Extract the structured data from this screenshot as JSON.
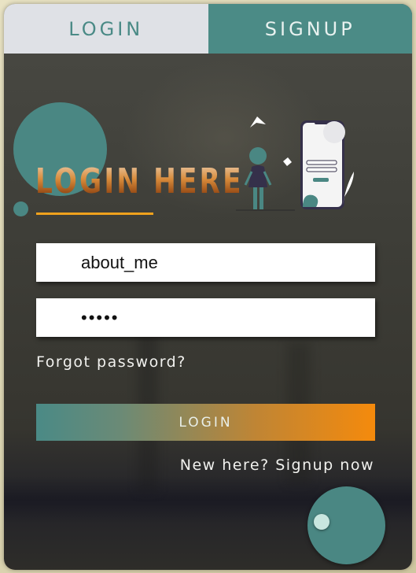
{
  "tabs": {
    "login_label": "LOGIN",
    "signup_label": "SIGNUP"
  },
  "headline": "LOGIN HERE",
  "form": {
    "username_value": "about_me",
    "password_value": "•••••",
    "forgot_label": "Forgot password?",
    "login_button_label": "LOGIN",
    "signup_prompt": "New here? Signup now"
  },
  "colors": {
    "accent_teal": "#4a8783",
    "accent_orange": "#f58a0c",
    "underline": "#f0a21d"
  },
  "icons": [
    "person-illustration",
    "phone-illustration"
  ]
}
